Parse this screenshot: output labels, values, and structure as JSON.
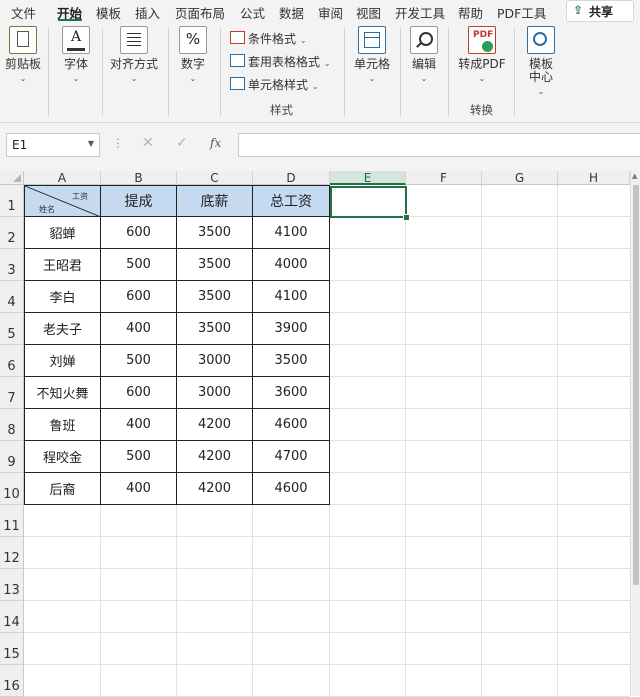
{
  "menu": {
    "items": [
      "文件",
      "开始",
      "模板",
      "插入",
      "页面布局",
      "公式",
      "数据",
      "审阅",
      "视图",
      "开发工具",
      "帮助",
      "PDF工具"
    ],
    "active": "开始",
    "share": "共享"
  },
  "ribbon": {
    "clipboard": "剪贴板",
    "font": "字体",
    "alignment": "对齐方式",
    "number": "数字",
    "conditional_format": "条件格式",
    "table_format": "套用表格格式",
    "cell_style": "单元格样式",
    "styles_group": "样式",
    "cells": "单元格",
    "editing": "编辑",
    "to_pdf": "转成PDF",
    "convert_group": "转换",
    "template_center": "模板中心",
    "accent_color": "#217346"
  },
  "formula_bar": {
    "name_box": "E1",
    "fx": "fx",
    "formula": ""
  },
  "sheet": {
    "columns": [
      "A",
      "B",
      "C",
      "D",
      "E",
      "F",
      "G",
      "H"
    ],
    "selected_column": "E",
    "rows": [
      "1",
      "2",
      "3",
      "4",
      "5",
      "6",
      "7",
      "8",
      "9",
      "10",
      "11",
      "12",
      "13",
      "14",
      "15",
      "16"
    ],
    "header_top": "工资",
    "header_bottom": "姓名",
    "headers": [
      "提成",
      "底薪",
      "总工资"
    ],
    "data": [
      [
        "貂蝉",
        "600",
        "3500",
        "4100"
      ],
      [
        "王昭君",
        "500",
        "3500",
        "4000"
      ],
      [
        "李白",
        "600",
        "3500",
        "4100"
      ],
      [
        "老夫子",
        "400",
        "3500",
        "3900"
      ],
      [
        "刘婵",
        "500",
        "3000",
        "3500"
      ],
      [
        "不知火舞",
        "600",
        "3000",
        "3600"
      ],
      [
        "鲁班",
        "400",
        "4200",
        "4600"
      ],
      [
        "程咬金",
        "500",
        "4200",
        "4700"
      ],
      [
        "后裔",
        "400",
        "4200",
        "4600"
      ]
    ],
    "header_fill": "#c5d9f1"
  }
}
